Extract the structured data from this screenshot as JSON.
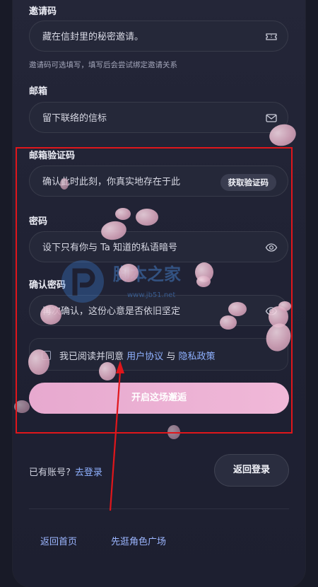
{
  "invite": {
    "label": "邀请码",
    "placeholder": "藏在信封里的秘密邀请。",
    "hint": "邀请码可选填写，填写后会尝试绑定邀请关系"
  },
  "email": {
    "label": "邮箱",
    "placeholder": "留下联络的信标"
  },
  "verify": {
    "label": "邮箱验证码",
    "placeholder": "确认此时此刻，你真实地存在于此",
    "button": "获取验证码"
  },
  "password": {
    "label": "密码",
    "placeholder": "设下只有你与 Ta 知道的私语暗号"
  },
  "confirm": {
    "label": "确认密码",
    "placeholder": "再次确认，这份心意是否依旧坚定"
  },
  "agree": {
    "prefix": "我已阅读并同意",
    "terms": "用户协议",
    "and": "与",
    "privacy": "隐私政策"
  },
  "submit": "开启这场邂逅",
  "login": {
    "question": "已有账号?",
    "link": "去登录",
    "back_button": "返回登录"
  },
  "footer": {
    "home": "返回首页",
    "explore": "先逛角色广场"
  },
  "watermark": {
    "text": "脚本之家",
    "sub": "www.jb51.net"
  },
  "colors": {
    "accent_link": "#8fb1ff",
    "primary_button": "#eeb4d6",
    "highlight_box": "#e0161b"
  }
}
